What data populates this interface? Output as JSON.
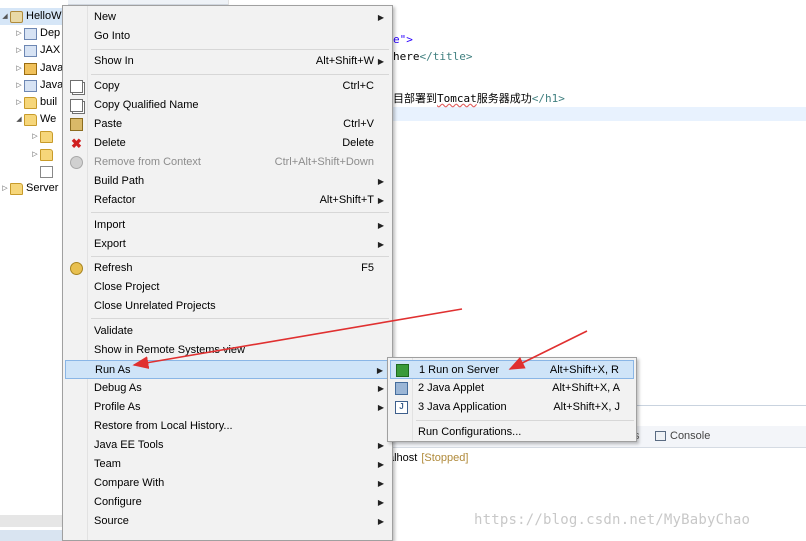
{
  "explorer": {
    "items": [
      {
        "label": "HelloW",
        "depth": 0,
        "expanded": true
      },
      {
        "label": "Dep",
        "depth": 1
      },
      {
        "label": "JAX",
        "depth": 1
      },
      {
        "label": "Java",
        "depth": 1
      },
      {
        "label": "Java",
        "depth": 1
      },
      {
        "label": "buil",
        "depth": 1
      },
      {
        "label": "We",
        "depth": 1,
        "expanded": true
      },
      {
        "label": "",
        "depth": 2
      },
      {
        "label": "",
        "depth": 2
      },
      {
        "label": "",
        "depth": 2
      },
      {
        "label": "Server",
        "depth": 0
      }
    ]
  },
  "editor": {
    "lines": [
      {
        "text_a": "e\">",
        "text_b": ""
      },
      {
        "text_a": "here",
        "text_b": "</title>"
      },
      {
        "text_a": "目部署到",
        "squiggle": "Tomcat",
        "text_c": "服务器成功",
        "tag": "</h1>"
      }
    ]
  },
  "panel": {
    "tab_fragment": "ts",
    "console_label": "Console",
    "server_name": "alhost",
    "server_status": "[Stopped]"
  },
  "menu": {
    "items": [
      {
        "label": "New",
        "shortcut": "",
        "submenu": true
      },
      {
        "label": "Go Into",
        "shortcut": ""
      },
      {
        "label": "Show In",
        "shortcut": "Alt+Shift+W",
        "submenu": true
      },
      {
        "label": "Copy",
        "shortcut": "Ctrl+C",
        "icon": "copy-icon"
      },
      {
        "label": "Copy Qualified Name",
        "shortcut": "",
        "icon": "copy-qualified-icon"
      },
      {
        "label": "Paste",
        "shortcut": "Ctrl+V",
        "icon": "paste-icon"
      },
      {
        "label": "Delete",
        "shortcut": "Delete",
        "icon": "delete-icon"
      },
      {
        "label": "Remove from Context",
        "shortcut": "Ctrl+Alt+Shift+Down",
        "icon": "remove-context-icon",
        "disabled": true
      },
      {
        "label": "Build Path",
        "shortcut": "",
        "submenu": true
      },
      {
        "label": "Refactor",
        "shortcut": "Alt+Shift+T",
        "submenu": true
      },
      {
        "label": "Import",
        "shortcut": "",
        "submenu": true
      },
      {
        "label": "Export",
        "shortcut": "",
        "submenu": true
      },
      {
        "label": "Refresh",
        "shortcut": "F5",
        "icon": "refresh-icon"
      },
      {
        "label": "Close Project",
        "shortcut": ""
      },
      {
        "label": "Close Unrelated Projects",
        "shortcut": ""
      },
      {
        "label": "Validate",
        "shortcut": ""
      },
      {
        "label": "Show in Remote Systems view",
        "shortcut": ""
      },
      {
        "label": "Run As",
        "shortcut": "",
        "submenu": true,
        "highlighted": true
      },
      {
        "label": "Debug As",
        "shortcut": "",
        "submenu": true
      },
      {
        "label": "Profile As",
        "shortcut": "",
        "submenu": true
      },
      {
        "label": "Restore from Local History...",
        "shortcut": ""
      },
      {
        "label": "Java EE Tools",
        "shortcut": "",
        "submenu": true
      },
      {
        "label": "Team",
        "shortcut": "",
        "submenu": true
      },
      {
        "label": "Compare With",
        "shortcut": "",
        "submenu": true
      },
      {
        "label": "Configure",
        "shortcut": "",
        "submenu": true
      },
      {
        "label": "Source",
        "shortcut": "",
        "submenu": true
      }
    ]
  },
  "submenu": {
    "items": [
      {
        "label": "1 Run on Server",
        "shortcut": "Alt+Shift+X, R",
        "icon": "run-server-icon",
        "highlighted": true
      },
      {
        "label": "2 Java Applet",
        "shortcut": "Alt+Shift+X, A",
        "icon": "java-applet-icon"
      },
      {
        "label": "3 Java Application",
        "shortcut": "Alt+Shift+X, J",
        "icon": "java-application-icon"
      },
      {
        "label": "Run Configurations...",
        "shortcut": ""
      }
    ]
  },
  "watermark": "https://blog.csdn.net/MyBabyChao",
  "colors": {
    "highlight": "#cfe4f8",
    "arrow": "#e03030"
  }
}
